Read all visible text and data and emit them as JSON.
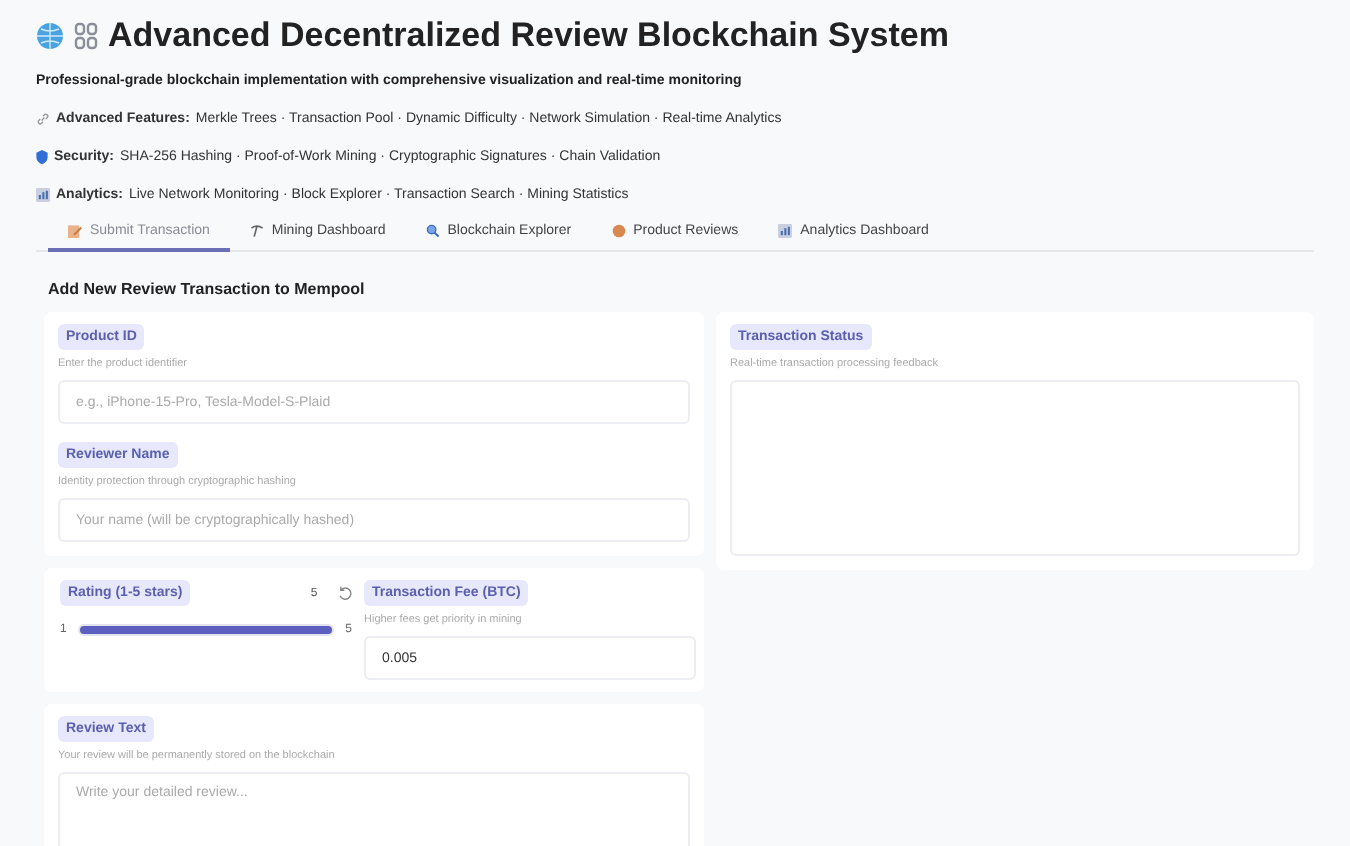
{
  "header": {
    "title": "Advanced Decentralized Review Blockchain System",
    "subtitle": "Professional-grade blockchain implementation with comprehensive visualization and real-time monitoring",
    "lines": [
      {
        "kind": "link",
        "label": "Advanced Features:",
        "text": "Merkle Trees · Transaction Pool · Dynamic Difficulty · Network Simulation · Real-time Analytics"
      },
      {
        "kind": "shield",
        "label": "Security:",
        "text": "SHA-256 Hashing · Proof-of-Work Mining · Cryptographic Signatures · Chain Validation"
      },
      {
        "kind": "chart",
        "label": "Analytics:",
        "text": "Live Network Monitoring · Block Explorer · Transaction Search · Mining Statistics"
      }
    ]
  },
  "tabs": [
    {
      "kind": "pencil",
      "label": "Submit Transaction",
      "selected": true
    },
    {
      "kind": "pick",
      "label": "Mining Dashboard",
      "selected": false
    },
    {
      "kind": "search",
      "label": "Blockchain Explorer",
      "selected": false
    },
    {
      "kind": "dot",
      "label": "Product Reviews",
      "selected": false
    },
    {
      "kind": "chart",
      "label": "Analytics Dashboard",
      "selected": false
    }
  ],
  "section_title": "Add New Review Transaction to Mempool",
  "product_id": {
    "label": "Product ID",
    "hint": "Enter the product identifier",
    "placeholder": "e.g., iPhone-15-Pro, Tesla-Model-S-Plaid"
  },
  "reviewer_name": {
    "label": "Reviewer Name",
    "hint": "Identity protection through cryptographic hashing",
    "placeholder": "Your name (will be cryptographically hashed)"
  },
  "rating": {
    "label": "Rating (1-5 stars)",
    "value": "5",
    "min": "1",
    "max": "5",
    "level": 1
  },
  "fee": {
    "label": "Transaction Fee (BTC)",
    "hint": "Higher fees get priority in mining",
    "value": "0.005"
  },
  "review_text": {
    "label": "Review Text",
    "hint": "Your review will be permanently stored on the blockchain",
    "placeholder": "Write your detailed review..."
  },
  "status": {
    "label": "Transaction Status",
    "hint": "Real-time transaction processing feedback"
  }
}
